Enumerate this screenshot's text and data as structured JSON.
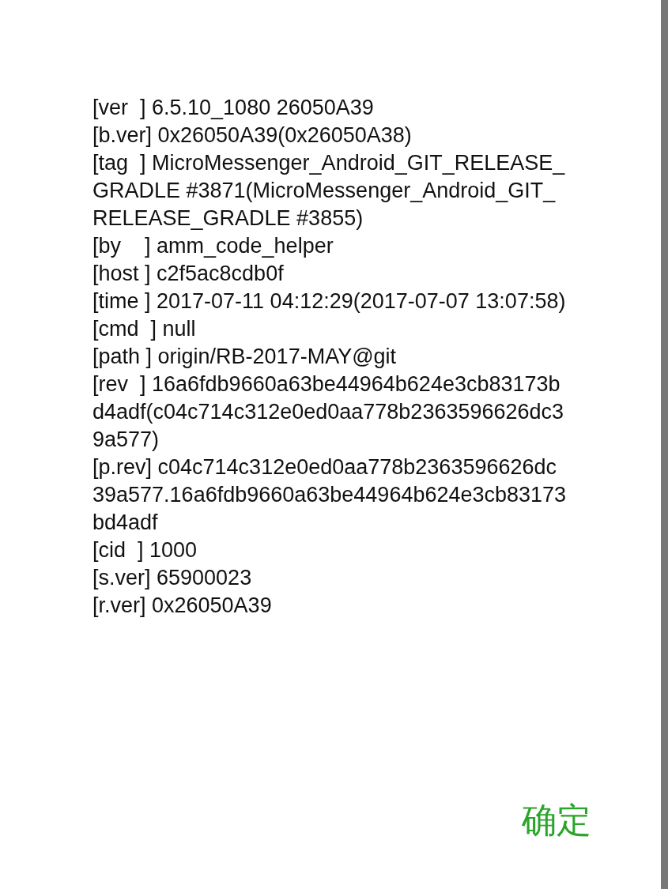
{
  "dialog": {
    "lines": [
      "[ver  ] 6.5.10_1080 26050A39",
      "[b.ver] 0x26050A39(0x26050A38)",
      "[tag  ] MicroMessenger_Android_GIT_RELEASE_GRADLE #3871(MicroMessenger_Android_GIT_RELEASE_GRADLE #3855)",
      "[by    ] amm_code_helper",
      "[host ] c2f5ac8cdb0f",
      "[time ] 2017-07-11 04:12:29(2017-07-07 13:07:58)",
      "[cmd  ] null",
      "[path ] origin/RB-2017-MAY@git",
      "[rev  ] 16a6fdb9660a63be44964b624e3cb83173bd4adf(c04c714c312e0ed0aa778b2363596626dc39a577)",
      "[p.rev] c04c714c312e0ed0aa778b2363596626dc39a577.16a6fdb9660a63be44964b624e3cb83173bd4adf",
      "[cid  ] 1000",
      "[s.ver] 65900023",
      "[r.ver] 0x26050A39"
    ],
    "button": "确定"
  }
}
